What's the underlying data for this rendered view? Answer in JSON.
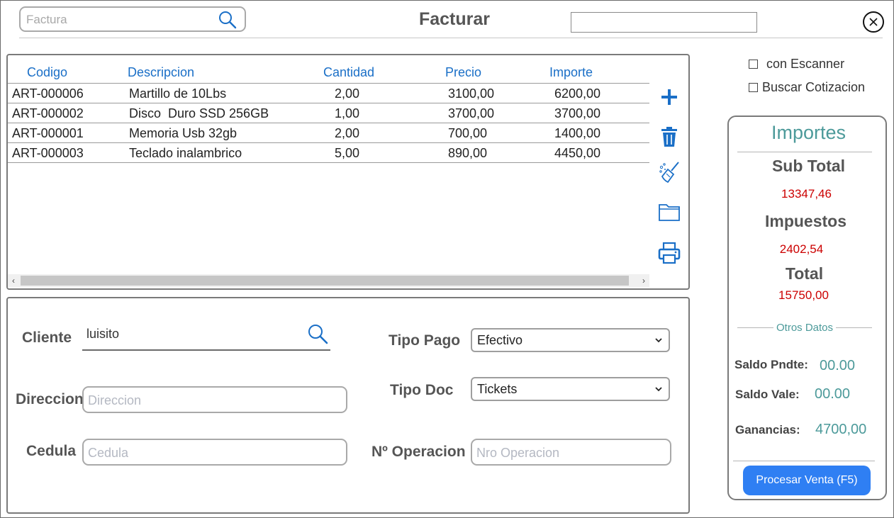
{
  "header": {
    "search_placeholder": "Factura",
    "title": "Facturar",
    "top_field_value": ""
  },
  "grid": {
    "columns": [
      "Codigo",
      "Descripcion",
      "Cantidad",
      "Precio",
      "Importe"
    ],
    "rows": [
      [
        "ART-000006",
        "Martillo de 10Lbs",
        "2,00",
        "3100,00",
        "6200,00"
      ],
      [
        "ART-000002",
        "Disco  Duro SSD 256GB",
        "1,00",
        "3700,00",
        "3700,00"
      ],
      [
        "ART-000001",
        "Memoria Usb 32gb",
        "2,00",
        "700,00",
        "1400,00"
      ],
      [
        "ART-000003",
        "Teclado inalambrico",
        "5,00",
        "890,00",
        "4450,00"
      ]
    ],
    "scroll_left": "‹",
    "scroll_right": "›"
  },
  "toolbar_icons": [
    "add-icon",
    "trash-icon",
    "broom-icon",
    "folder-icon",
    "printer-icon"
  ],
  "form": {
    "cliente_label": "Cliente",
    "cliente_value": "luisito",
    "direccion_label": "Direccion",
    "direccion_placeholder": "Direccion",
    "cedula_label": "Cedula",
    "cedula_placeholder": "Cedula",
    "tipo_pago_label": "Tipo Pago",
    "tipo_pago_value": "Efectivo",
    "tipo_doc_label": "Tipo Doc",
    "tipo_doc_value": "Tickets",
    "operacion_label": "Nº Operacion",
    "operacion_placeholder": "Nro Operacion"
  },
  "options": {
    "escanner_label": "con Escanner",
    "cotizacion_label": "Buscar Cotizacion"
  },
  "importes": {
    "title": "Importes",
    "subtotal_label": "Sub Total",
    "subtotal_value": "13347,46",
    "impuestos_label": "Impuestos",
    "impuestos_value": "2402,54",
    "total_label": "Total",
    "total_value": "15750,00",
    "otros_label": "Otros Datos",
    "saldo_pendiente_label": "Saldo Pndte:",
    "saldo_pendiente_value": "00.00",
    "saldo_vale_label": "Saldo Vale:",
    "saldo_vale_value": "00.00",
    "ganancias_label": "Ganancias:",
    "ganancias_value": "4700,00",
    "procesar_label": "Procesar Venta (F5)"
  },
  "colors": {
    "accent_blue": "#1a6fc7",
    "button_blue": "#2f7ff3",
    "teal": "#4c9a9a",
    "amount_red": "#cc0000"
  }
}
